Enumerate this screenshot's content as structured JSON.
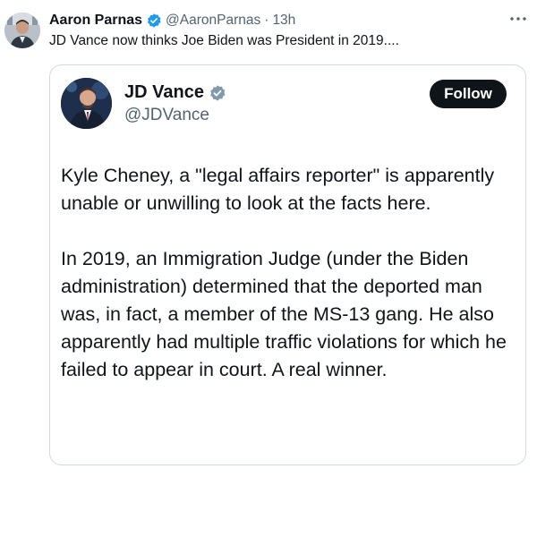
{
  "outer_post": {
    "author_name": "Aaron Parnas",
    "handle": "@AaronParnas",
    "separator": "·",
    "time": "13h",
    "text": "JD Vance now thinks Joe Biden was President in 2019....",
    "avatar_icon": "profile-photo",
    "more_icon": "more-horizontal-icon"
  },
  "quoted_post": {
    "author_name": "JD Vance",
    "handle": "@JDVance",
    "follow_label": "Follow",
    "avatar_icon": "profile-photo",
    "paragraphs": [
      "Kyle Cheney, a \"legal affairs reporter\" is apparently unable or unwilling to look at the facts here.",
      "In 2019, an Immigration Judge (under the Biden administration) determined that the deported man was, in fact, a member of the MS-13 gang. He also apparently had multiple traffic violations for which he failed to appear in court. A real winner."
    ]
  },
  "colors": {
    "verified_blue": "#1d9bf0",
    "text_primary": "#0f1419",
    "text_secondary": "#536471",
    "border": "#cfd9de",
    "follow_bg": "#0f1419"
  }
}
